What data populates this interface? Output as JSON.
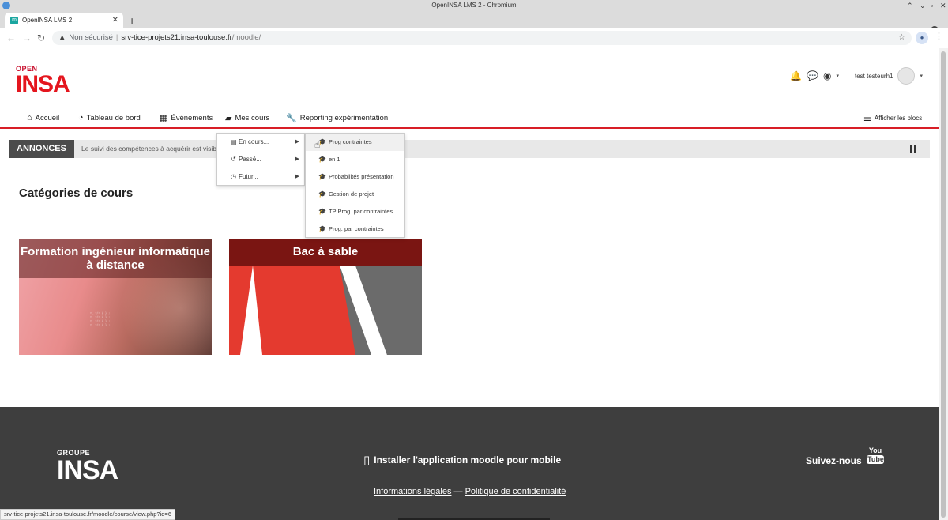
{
  "window": {
    "title": "OpenINSA LMS 2 - Chromium"
  },
  "tab": {
    "title": "OpenINSA LMS 2"
  },
  "address": {
    "insecure": "Non sécurisé",
    "host": "srv-tice-projets21.insa-toulouse.fr",
    "path": "/moodle/"
  },
  "brand": {
    "small": "OPEN",
    "big": "INSA"
  },
  "user": {
    "name": "test testeurh1"
  },
  "nav": {
    "home": "Accueil",
    "dashboard": "Tableau de bord",
    "events": "Événements",
    "mycourses": "Mes cours",
    "reporting": "Reporting expérimentation",
    "blocks": "Afficher les blocs"
  },
  "announce": {
    "label": "ANNONCES",
    "text": "Le suivi des compétences à acquérir est visib"
  },
  "menu1": [
    {
      "label": "En cours..."
    },
    {
      "label": "Passé..."
    },
    {
      "label": "Futur..."
    }
  ],
  "menu2": [
    {
      "label": "Prog contraintes"
    },
    {
      "label": "en 1"
    },
    {
      "label": "Probabilités présentation"
    },
    {
      "label": "Gestion de projet"
    },
    {
      "label": "TP Prog. par contraintes"
    },
    {
      "label": "Prog. par contraintes"
    }
  ],
  "categories": {
    "title": "Catégories de cours",
    "cards": [
      {
        "title": "Formation ingénieur informatique à distance"
      },
      {
        "title": "Bac à sable"
      }
    ]
  },
  "footer": {
    "groupe": "GROUPE",
    "insa": "INSA",
    "app": "Installer l'application moodle pour mobile",
    "legal": "Informations légales",
    "dash": "—",
    "privacy": "Politique de confidentialité",
    "follow": "Suivez-nous",
    "yt_you": "You",
    "yt_tube": "Tube"
  },
  "status": {
    "url": "srv-tice-projets21.insa-toulouse.fr/moodle/course/view.php?id=6"
  },
  "colors": {
    "brand_red": "#e4161e",
    "footer_bg": "#3e3e3e",
    "announce_label": "#4b4b4b"
  }
}
